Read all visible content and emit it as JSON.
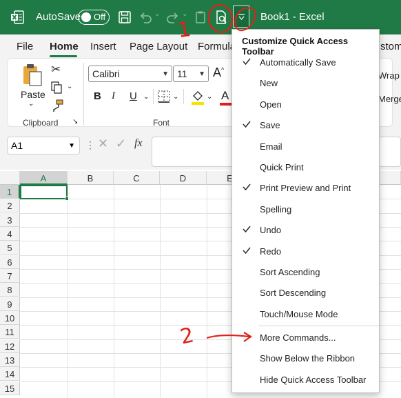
{
  "titlebar": {
    "autosave_label": "AutoSave",
    "autosave_state": "Off",
    "title": "Book1  -  Excel",
    "accent_color": "#1f7a45"
  },
  "tabs": [
    "File",
    "Home",
    "Insert",
    "Page Layout",
    "Formula",
    "stoma"
  ],
  "ribbon": {
    "paste_label": "Paste",
    "clipboard_label": "Clipboard",
    "font_label": "Font",
    "font_name": "Calibri",
    "font_size": "11",
    "bold": "B",
    "italic": "I",
    "underline": "U",
    "wrap_label": "Wrap",
    "merge_label": "Merge"
  },
  "formula_bar": {
    "name_box": "A1",
    "fx": "fx"
  },
  "grid": {
    "columns": [
      "A",
      "B",
      "C",
      "D",
      "E"
    ],
    "rows": [
      "1",
      "2",
      "3",
      "4",
      "5",
      "6",
      "7",
      "8",
      "9",
      "10",
      "11",
      "12",
      "13",
      "14",
      "15"
    ],
    "active_cell": "A1"
  },
  "menu": {
    "title": "Customize Quick Access Toolbar",
    "items": [
      {
        "label": "Automatically Save",
        "checked": true
      },
      {
        "label": "New",
        "checked": false
      },
      {
        "label": "Open",
        "checked": false
      },
      {
        "label": "Save",
        "checked": true
      },
      {
        "label": "Email",
        "checked": false
      },
      {
        "label": "Quick Print",
        "checked": false
      },
      {
        "label": "Print Preview and Print",
        "checked": true
      },
      {
        "label": "Spelling",
        "checked": false
      },
      {
        "label": "Undo",
        "checked": true
      },
      {
        "label": "Redo",
        "checked": true
      },
      {
        "label": "Sort Ascending",
        "checked": false
      },
      {
        "label": "Sort Descending",
        "checked": false
      },
      {
        "label": "Touch/Mouse Mode",
        "checked": false
      }
    ],
    "more_commands": "More Commands...",
    "show_below": "Show Below the Ribbon",
    "hide_toolbar": "Hide Quick Access Toolbar"
  },
  "annotations": {
    "step1": "1",
    "step2": "2",
    "color": "#e0201b"
  }
}
